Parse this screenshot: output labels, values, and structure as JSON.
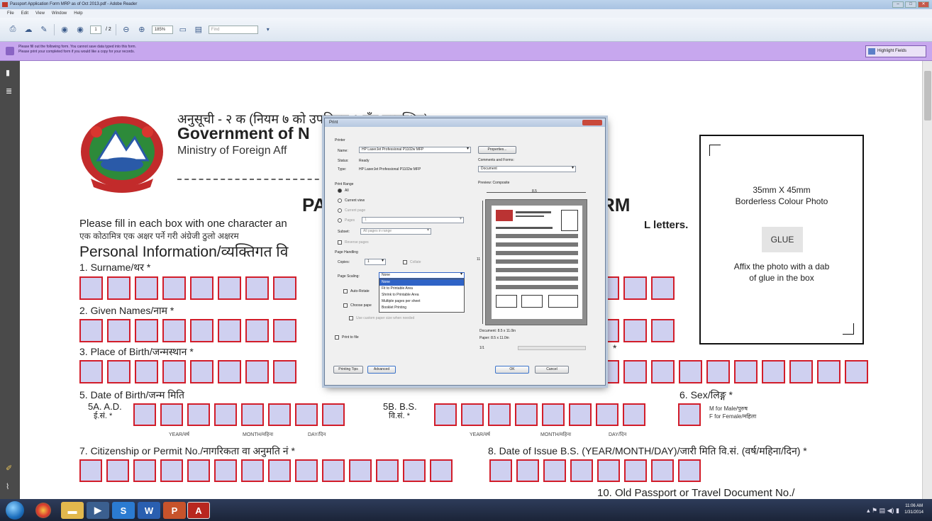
{
  "window": {
    "title": "Passport Application Form MRP as of Oct 2013.pdf - Adobe Reader",
    "menu": [
      "File",
      "Edit",
      "View",
      "Window",
      "Help"
    ]
  },
  "toolbar": {
    "page_current": "1",
    "page_total": "/ 2",
    "zoom": "185%",
    "find_placeholder": "Find"
  },
  "formbar": {
    "message_line1": "Please fill out the following form. You cannot save data typed into this form.",
    "message_line2": "Please print your completed form if you would like a copy for your records.",
    "highlight_label": "Highlight Fields"
  },
  "document": {
    "header_devanagari": "अनुसूची - २ क (नियम ७ को उपनियम १ सँग सम्बन्धित)",
    "header_gov": "Government of N",
    "header_ministry": "Ministry of Foreign Aff",
    "title_left": "PA",
    "title_right": "RM",
    "instruction": "Please fill in each box with one character an",
    "instruction_devanagari": "एक कोठामित्र एक अक्षर पर्ने गरी अंग्रेजी ठुलो अक्षरम",
    "instruction_end": "L letters.",
    "section_title": "Personal Information/व्यक्तिगत वि",
    "surname_label": "1. Surname/थर *",
    "given_names_label": "2. Given Names/नाम *",
    "place_of_birth_label": "3. Place of Birth/जन्मस्थान *",
    "star4": "*",
    "dob_label": "5. Date of Birth/जन्म मिति",
    "dob_ad_label": "5A. A.D.",
    "dob_ad_dev": "ई.सं. *",
    "dob_bs_label": "5B. B.S.",
    "dob_bs_dev": "वि.सं. *",
    "year": "YEAR/वर्ष",
    "month": "MONTH/महिना",
    "day": "DAY/दिन",
    "sex_label": "6. Sex/लिङ्ग *",
    "sex_m": "M for Male/पुरुष",
    "sex_f": "F for Female/महिला",
    "citizenship_label": "7. Citizenship or Permit No./नागरिकता वा अनुमति नं *",
    "date_of_issue_label": "8. Date of Issue B.S. (YEAR/MONTH/DAY)/जारी मिति वि.सं. (वर्ष/महिना/दिन) *",
    "old_passport_label": "10. Old Passport or Travel Document No./",
    "photo_line1": "35mm X 45mm",
    "photo_line2": "Borderless Colour Photo",
    "glue": "GLUE",
    "photo_line3": "Affix the photo with a dab",
    "photo_line4": "of glue in the box"
  },
  "print_dialog": {
    "title": "Print",
    "printer_group": "Printer",
    "name_label": "Name:",
    "name_value": "HP LaserJet Professional P1102w MFP",
    "properties_button": "Properties...",
    "status_label": "Status:",
    "status_value": "Ready",
    "type_label": "Type:",
    "type_value": "HP LaserJet Professional P1102w MFP",
    "comments_forms_label": "Comments and Forms:",
    "comments_forms_value": "Document",
    "print_range_label": "Print Range",
    "all_label": "All",
    "current_view_label": "Current view",
    "current_page_label": "Current page",
    "pages_label": "Pages",
    "pages_value": "1",
    "subset_label": "Subset:",
    "subset_value": "All pages in range",
    "reverse_label": "Reverse pages",
    "page_handling_label": "Page Handling",
    "copies_label": "Copies:",
    "copies_value": "1",
    "collate_label": "Collate",
    "page_scaling_label": "Page Scaling:",
    "page_scaling_value": "None",
    "scaling_options": [
      "None",
      "Fit to Printable Area",
      "Shrink to Printable Area",
      "Multiple pages per sheet",
      "Booklet Printing"
    ],
    "auto_rotate_label": "Auto-Rotate",
    "choose_paper_label": "Choose pape",
    "custom_paper_label": "Use custom paper size when needed",
    "print_to_file_label": "Print to file",
    "preview_label": "Preview: Composite",
    "preview_width": "8.5",
    "preview_height": "11",
    "document_size": "Document: 8.5 x 11.0in",
    "paper_size": "Paper: 8.5 x 11.0in",
    "page_counter": "1/1",
    "printing_tips_button": "Printing Tips",
    "advanced_button": "Advanced",
    "ok_button": "OK",
    "cancel_button": "Cancel"
  },
  "taskbar": {
    "clock_time": "11:06 AM",
    "clock_date": "1/31/2014"
  }
}
